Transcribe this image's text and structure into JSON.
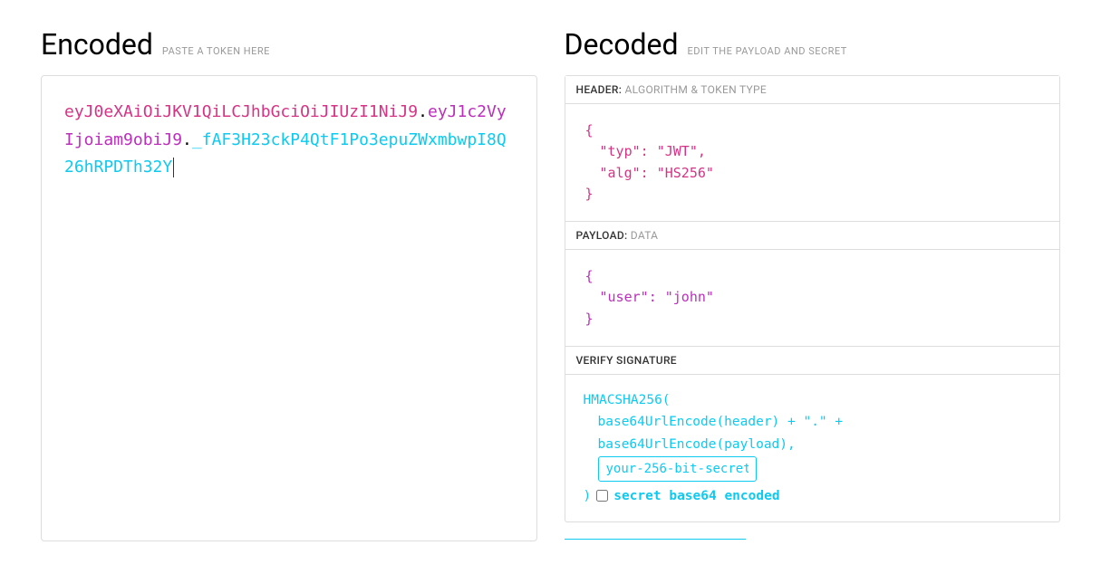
{
  "encoded": {
    "title": "Encoded",
    "subtitle": "PASTE A TOKEN HERE",
    "token_header": "eyJ0eXAiOiJKV1QiLCJhbGciOiJIUzI1NiJ9",
    "token_payload": "eyJ1c2VyIjoiam9obiJ9",
    "token_signature": "_fAF3H23ckP4QtF1Po3epuZWxmbwpI8Q26hRPDTh32Y"
  },
  "decoded": {
    "title": "Decoded",
    "subtitle": "EDIT THE PAYLOAD AND SECRET",
    "header_panel": {
      "label": "HEADER:",
      "sub": "ALGORITHM & TOKEN TYPE",
      "rows": [
        {
          "key": "typ",
          "value": "JWT",
          "trailing_comma": true
        },
        {
          "key": "alg",
          "value": "HS256",
          "trailing_comma": false
        }
      ]
    },
    "payload_panel": {
      "label": "PAYLOAD:",
      "sub": "DATA",
      "rows": [
        {
          "key": "user",
          "value": "john",
          "trailing_comma": false
        }
      ]
    },
    "signature_panel": {
      "label": "VERIFY SIGNATURE",
      "line1": "HMACSHA256(",
      "line2": "base64UrlEncode(header) + \".\" +",
      "line3": "base64UrlEncode(payload),",
      "secret_value": "your-256-bit-secret",
      "close_paren": ")",
      "checkbox_label": "secret base64 encoded",
      "checkbox_checked": false
    }
  }
}
